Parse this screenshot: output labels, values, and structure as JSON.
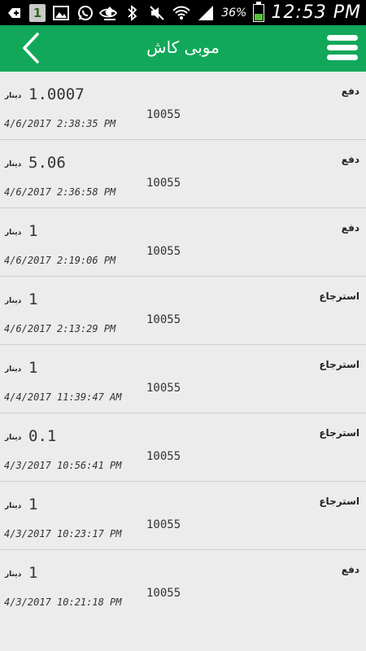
{
  "status_bar": {
    "time": "12:53 PM",
    "battery": "36%",
    "battery_level": 0.36,
    "left_icons": [
      "add-icon",
      "notification-one-icon",
      "gallery-icon",
      "whatsapp-icon",
      "upload-icon"
    ],
    "right_icons": [
      "eye-icon",
      "bluetooth-icon",
      "mute-icon",
      "wifi-icon",
      "signal-icon",
      "battery-icon"
    ],
    "notification_badge": "1"
  },
  "appbar": {
    "title": "موبی کاش",
    "color": "#12a85a"
  },
  "transactions": [
    {
      "type": "دفع",
      "amount": "1.0007",
      "currency": "دینار",
      "code": "10055",
      "date": "4/6/2017 2:38:35 PM"
    },
    {
      "type": "دفع",
      "amount": "5.06",
      "currency": "دینار",
      "code": "10055",
      "date": "4/6/2017 2:36:58 PM"
    },
    {
      "type": "دفع",
      "amount": "1",
      "currency": "دینار",
      "code": "10055",
      "date": "4/6/2017 2:19:06 PM"
    },
    {
      "type": "استرجاع",
      "amount": "1",
      "currency": "دینار",
      "code": "10055",
      "date": "4/6/2017 2:13:29 PM"
    },
    {
      "type": "استرجاع",
      "amount": "1",
      "currency": "دینار",
      "code": "10055",
      "date": "4/4/2017 11:39:47 AM"
    },
    {
      "type": "استرجاع",
      "amount": "0.1",
      "currency": "دینار",
      "code": "10055",
      "date": "4/3/2017 10:56:41 PM"
    },
    {
      "type": "استرجاع",
      "amount": "1",
      "currency": "دینار",
      "code": "10055",
      "date": "4/3/2017 10:23:17 PM"
    },
    {
      "type": "دفع",
      "amount": "1",
      "currency": "دینار",
      "code": "10055",
      "date": "4/3/2017 10:21:18 PM"
    }
  ]
}
